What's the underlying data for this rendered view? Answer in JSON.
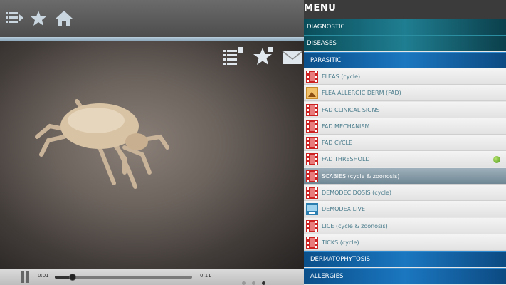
{
  "toolbar": {
    "icons": [
      "playlist-icon",
      "star-icon",
      "home-icon"
    ]
  },
  "video_overlay": {
    "icons": [
      "playlist-add-icon",
      "favorite-add-icon",
      "mail-icon"
    ]
  },
  "player": {
    "current_time": "0:01",
    "duration": "0:11",
    "progress_fraction": 0.13,
    "page_dots": 3,
    "active_dot": 2
  },
  "menu": {
    "title": "MENU",
    "categories_top": [
      {
        "label": "DIAGNOSTIC",
        "style": "teal"
      },
      {
        "label": "DISEASES",
        "style": "teal"
      },
      {
        "label": "PARASITIC",
        "style": "blue"
      }
    ],
    "items": [
      {
        "label": "FLEAS (cycle)",
        "thumb": "video-thumb-icon"
      },
      {
        "label": "FLEA ALLERGIC DERM (FAD)",
        "thumb": "image-thumb-icon"
      },
      {
        "label": "FAD CLINICAL SIGNS",
        "thumb": "video-thumb-icon"
      },
      {
        "label": "FAD MECHANISM",
        "thumb": "video-thumb-icon"
      },
      {
        "label": "FAD CYCLE",
        "thumb": "video-thumb-icon"
      },
      {
        "label": "FAD THRESHOLD",
        "thumb": "video-thumb-icon",
        "status": "green"
      },
      {
        "label": "SCABIES (cycle & zoonosis)",
        "thumb": "video-thumb-icon",
        "selected": true
      },
      {
        "label": "DEMODECIDOSIS (cycle)",
        "thumb": "video-thumb-icon"
      },
      {
        "label": "DEMODEX LIVE",
        "thumb": "live-thumb-icon"
      },
      {
        "label": "LICE (cycle & zoonosis)",
        "thumb": "video-thumb-icon"
      },
      {
        "label": "TICKS (cycle)",
        "thumb": "video-thumb-icon"
      }
    ],
    "categories_bottom": [
      {
        "label": "DERMATOPHYTOSIS",
        "style": "blue"
      },
      {
        "label": "ALLERGIES",
        "style": "blue"
      }
    ]
  },
  "colors": {
    "item_text": "#4a7c8c",
    "teal_category": "#1f7e91",
    "blue_category": "#1b77c0",
    "selected_item": "#6f8794"
  }
}
